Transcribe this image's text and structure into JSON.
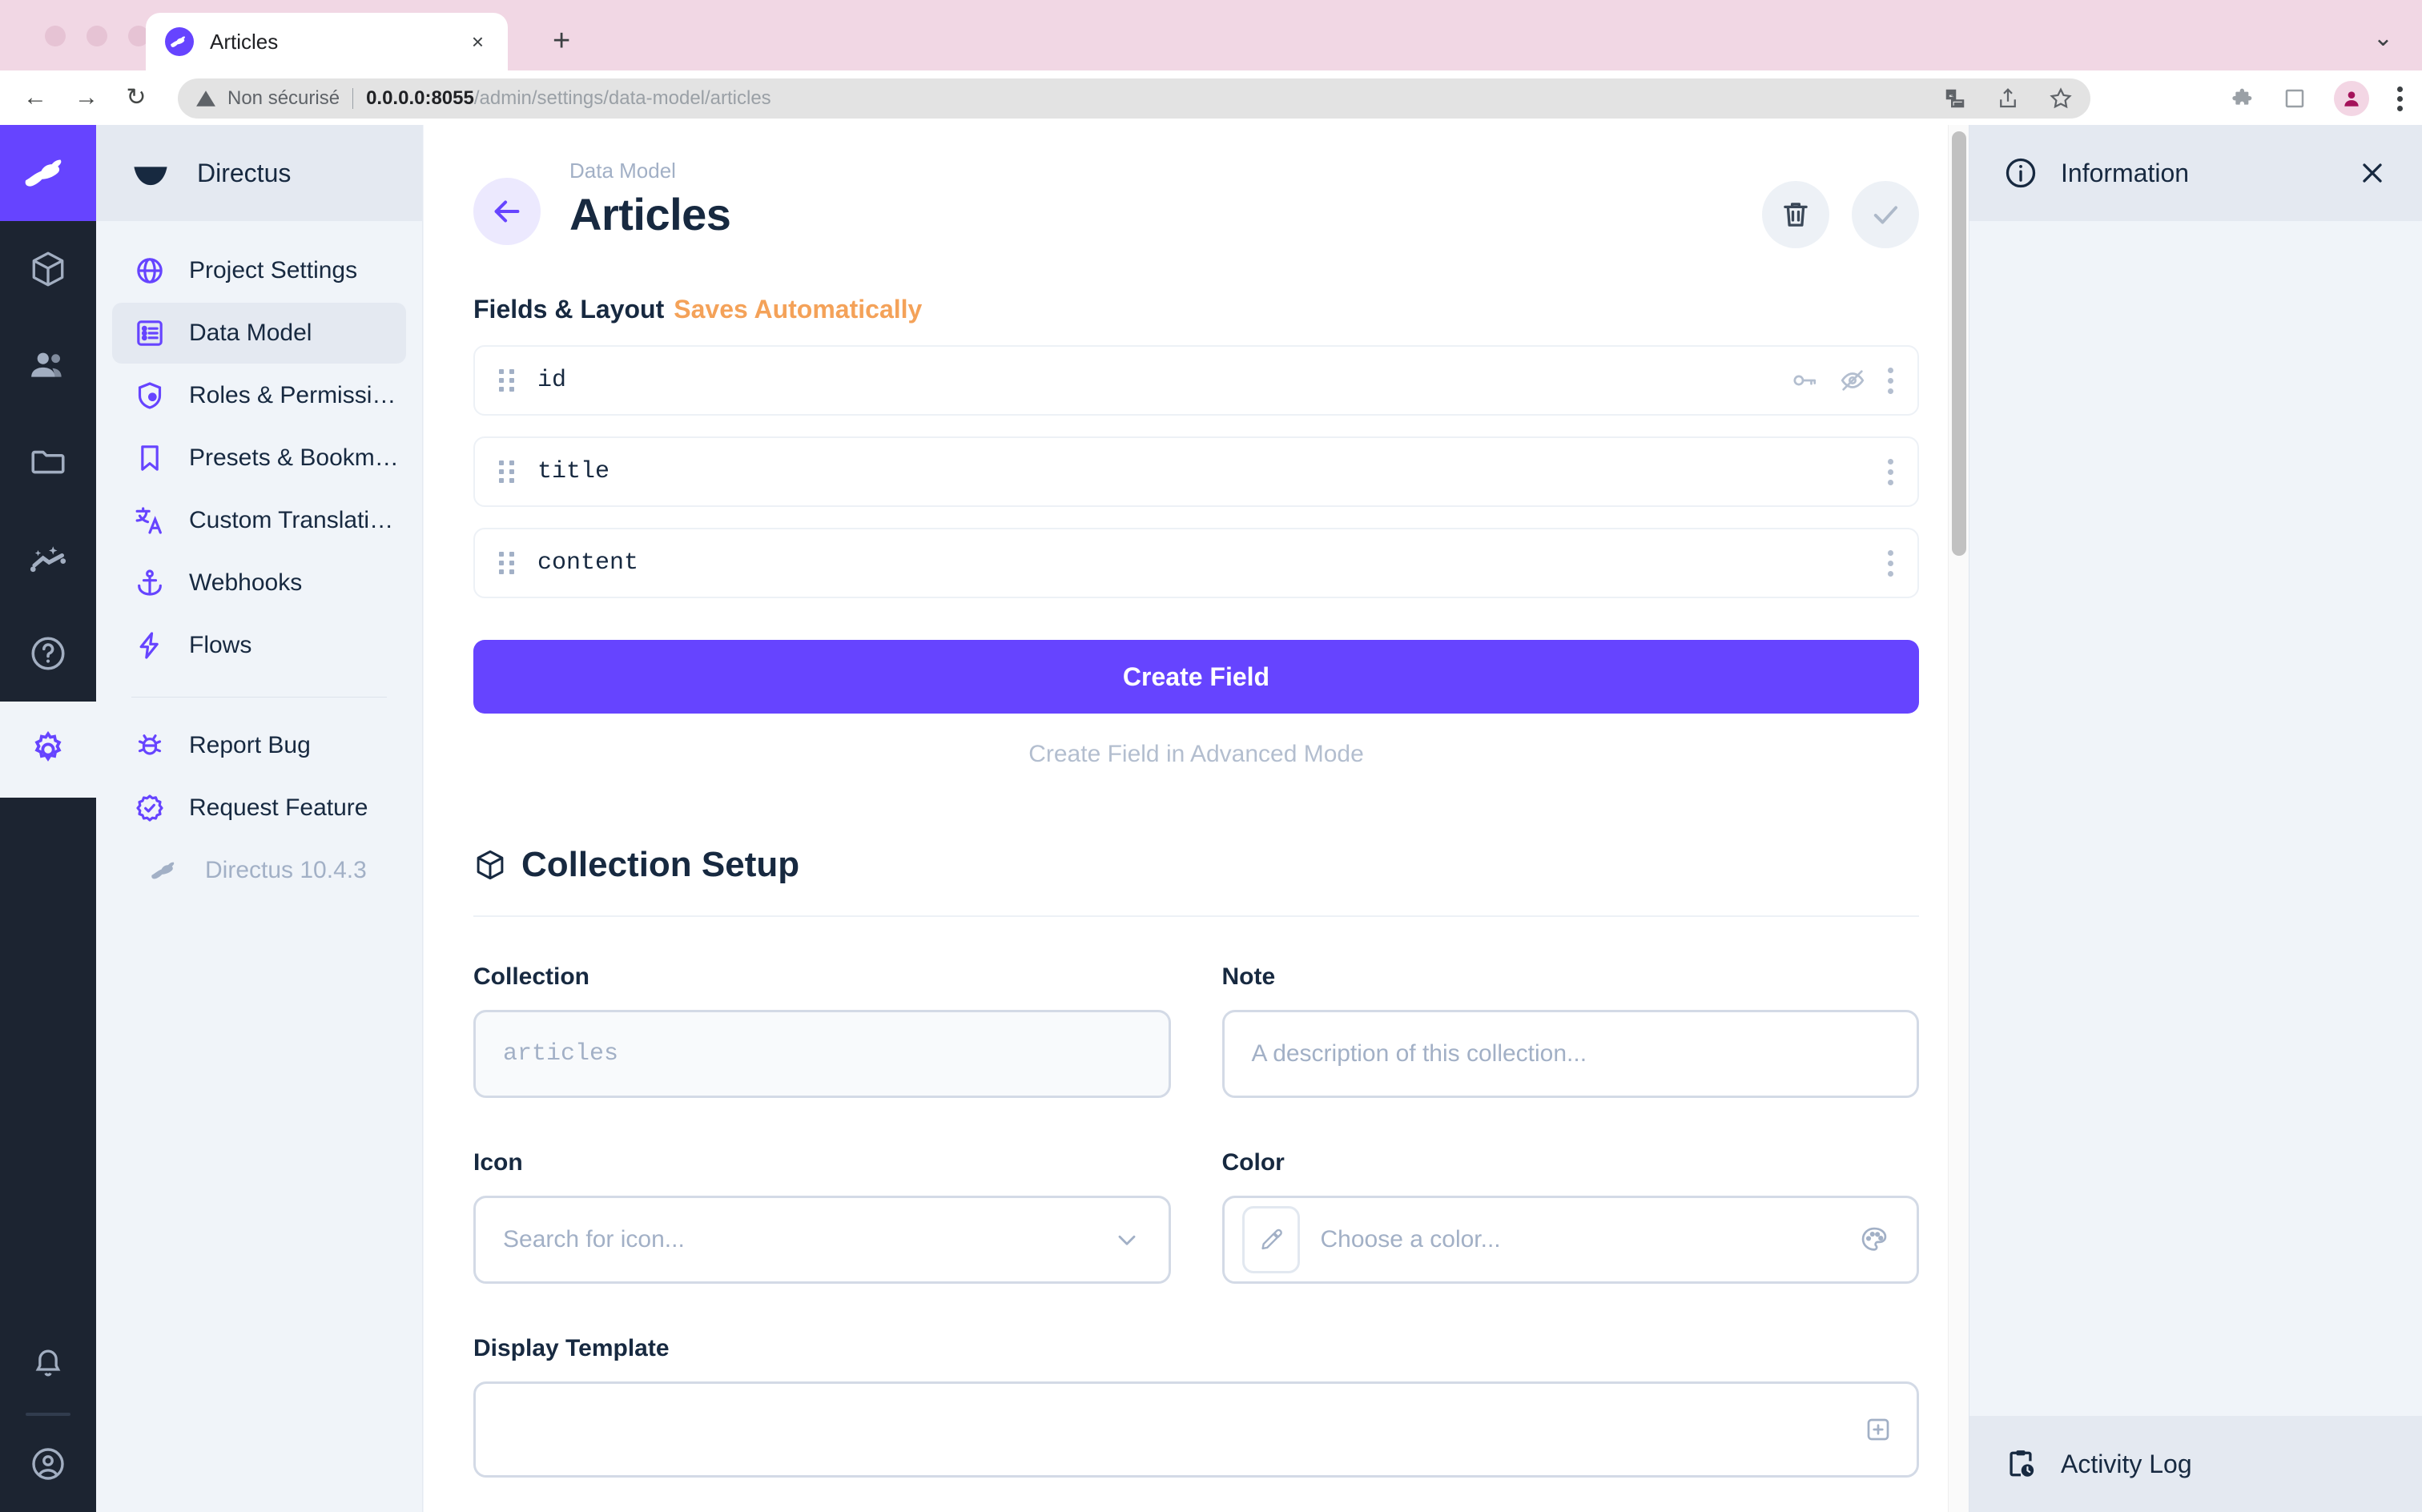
{
  "browser": {
    "tab": {
      "title": "Articles",
      "favicon": "directus-rabbit-icon",
      "close_label": "×"
    },
    "new_tab_label": "+",
    "window_caret": "⌄",
    "toolbar": {
      "back": "←",
      "forward": "→",
      "reload": "↻",
      "security_text": "Non sécurisé",
      "url_host": "0.0.0.0:8055",
      "url_path": "/admin/settings/data-model/articles",
      "icons": [
        "translate-icon",
        "share-icon",
        "bookmark-star-icon",
        "extensions-puzzle-icon",
        "side-panel-icon",
        "profile-avatar-icon",
        "chrome-menu-icon"
      ]
    }
  },
  "module_bar": {
    "logo": "directus-rabbit-logo",
    "items": [
      {
        "name": "content",
        "icon": "box-icon",
        "active": false
      },
      {
        "name": "user-directory",
        "icon": "people-icon",
        "active": false
      },
      {
        "name": "file-library",
        "icon": "folder-icon",
        "active": false
      },
      {
        "name": "insights",
        "icon": "sparkline-icon",
        "active": false
      },
      {
        "name": "docs",
        "icon": "help-circle-icon",
        "active": false
      },
      {
        "name": "settings",
        "icon": "gear-icon",
        "active": true
      }
    ],
    "bottom": [
      {
        "name": "notifications",
        "icon": "bell-icon"
      },
      {
        "name": "account",
        "icon": "user-circle-icon"
      }
    ]
  },
  "sidebar": {
    "header": {
      "title": "Directus",
      "icon": "directus-wedge-icon"
    },
    "items": [
      {
        "label": "Project Settings",
        "icon": "globe-icon",
        "active": false
      },
      {
        "label": "Data Model",
        "icon": "list-box-icon",
        "active": true
      },
      {
        "label": "Roles & Permissions",
        "icon": "shield-person-icon",
        "active": false
      },
      {
        "label": "Presets & Bookmar…",
        "icon": "bookmark-icon",
        "active": false
      },
      {
        "label": "Custom Translations",
        "icon": "translate-a-icon",
        "active": false
      },
      {
        "label": "Webhooks",
        "icon": "anchor-icon",
        "active": false
      },
      {
        "label": "Flows",
        "icon": "bolt-icon",
        "active": false
      }
    ],
    "secondary_items": [
      {
        "label": "Report Bug",
        "icon": "bug-icon"
      },
      {
        "label": "Request Feature",
        "icon": "badge-check-icon"
      }
    ],
    "version": {
      "label": "Directus 10.4.3",
      "icon": "rabbit-icon"
    }
  },
  "header": {
    "back_icon": "arrow-left-icon",
    "breadcrumb": "Data Model",
    "title": "Articles",
    "actions": [
      {
        "name": "delete-collection",
        "icon": "trash-icon"
      },
      {
        "name": "save-collection",
        "icon": "check-icon"
      }
    ]
  },
  "fields_section": {
    "label": "Fields & Layout",
    "auto_save_text": "Saves Automatically",
    "fields": [
      {
        "name": "id",
        "icons": [
          "key-icon",
          "eye-off-icon",
          "more-vertical-icon"
        ]
      },
      {
        "name": "title",
        "icons": [
          "more-vertical-icon"
        ]
      },
      {
        "name": "content",
        "icons": [
          "more-vertical-icon"
        ]
      }
    ],
    "create_button": "Create Field",
    "advanced_link": "Create Field in Advanced Mode"
  },
  "collection_setup": {
    "heading": "Collection Setup",
    "heading_icon": "box-outline-icon",
    "fields": [
      {
        "label": "Collection",
        "placeholder": "articles",
        "value": "",
        "readonly": true,
        "mono": true
      },
      {
        "label": "Note",
        "placeholder": "A description of this collection...",
        "value": "",
        "readonly": false,
        "mono": false
      },
      {
        "label": "Icon",
        "placeholder": "Search for icon...",
        "value": "",
        "trailing_icon": "chevron-down-icon"
      },
      {
        "label": "Color",
        "placeholder": "Choose a color...",
        "value": "",
        "leading_icon": "eyedropper-icon",
        "trailing_icon": "palette-icon"
      }
    ],
    "display_template": {
      "label": "Display Template",
      "value": "",
      "trailing_icon": "add-box-icon"
    }
  },
  "drawer": {
    "title": "Information",
    "title_icon": "info-circle-icon",
    "close_icon": "close-icon",
    "footer_title": "Activity Log",
    "footer_icon": "clipboard-clock-icon"
  },
  "colors": {
    "accent": "#6644ff",
    "warning": "#f4a259",
    "dark_navy": "#172940",
    "module_bar": "#1c2431",
    "sidebar_bg": "#f0f4f9",
    "tabstrip_pink": "#f1d7e4"
  }
}
